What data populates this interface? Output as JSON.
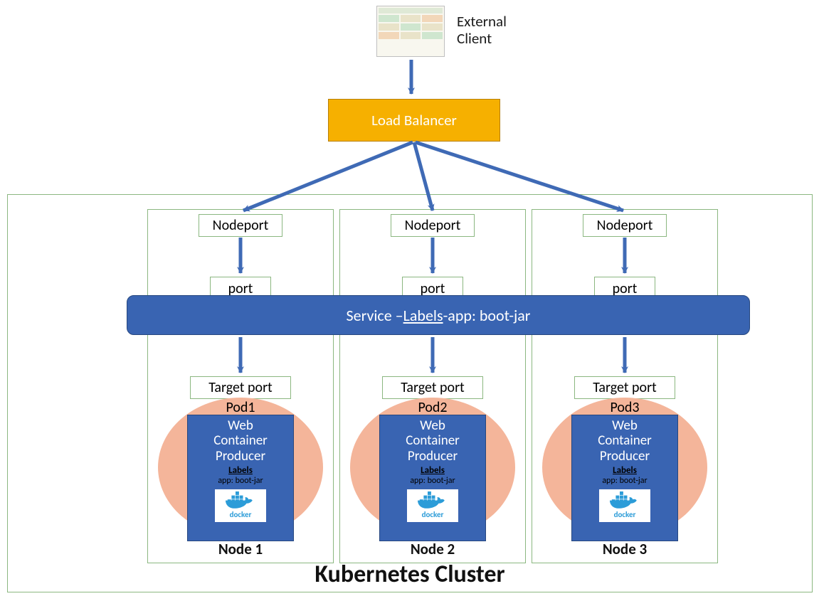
{
  "externalClient": {
    "line1": "External",
    "line2": "Client"
  },
  "loadBalancer": {
    "label": "Load Balancer"
  },
  "cluster": {
    "title": "Kubernetes Cluster"
  },
  "service": {
    "prefix": "Service – ",
    "labelsWord": "Labels",
    "suffix": "-app: boot-jar"
  },
  "common": {
    "nodeport": "Nodeport",
    "port": "port",
    "targetport": "Target port",
    "containerTitle1": "Web",
    "containerTitle2": "Container",
    "containerTitle3": "Producer",
    "labelsWord": "Labels",
    "labelsValue": "app: boot-jar",
    "dockerWord": "docker"
  },
  "nodes": [
    {
      "podName": "Pod1",
      "nodeLabel": "Node 1"
    },
    {
      "podName": "Pod2",
      "nodeLabel": "Node 2"
    },
    {
      "podName": "Pod3",
      "nodeLabel": "Node 3"
    }
  ],
  "colors": {
    "loadBalancerBg": "#F6B000",
    "serviceBg": "#3964B2",
    "podBg": "#F4B59A",
    "borderGreen": "#8bb780",
    "arrow": "#3F6AB5"
  }
}
